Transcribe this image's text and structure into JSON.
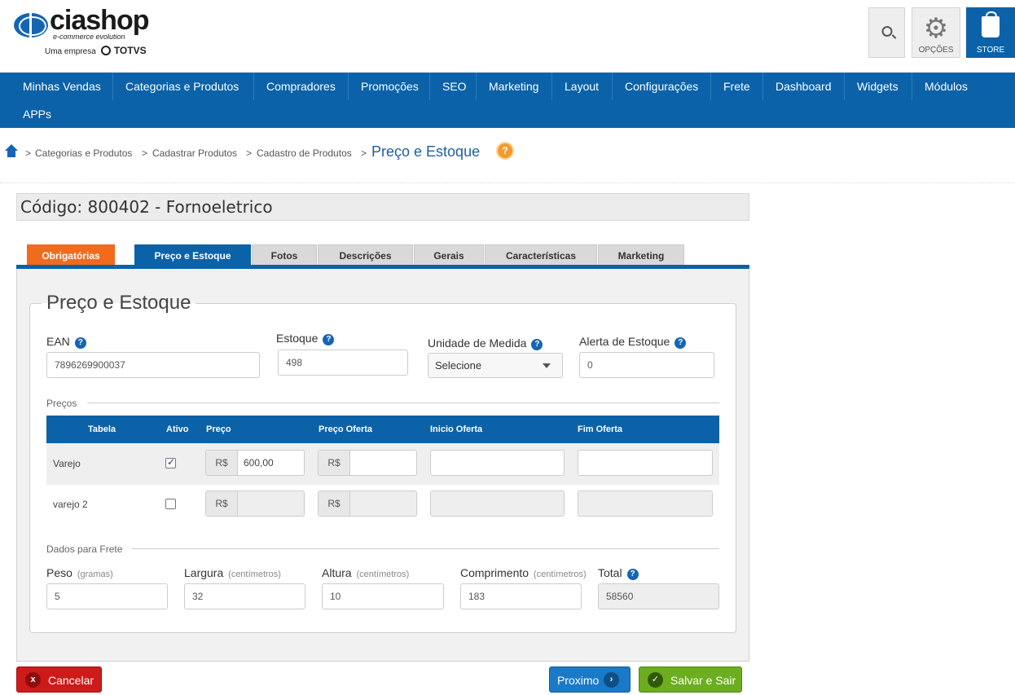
{
  "brand": {
    "name": "ciashop",
    "tagline": "e-commerce evolution",
    "sub_prefix": "Uma empresa",
    "sub_brand": "TOTVS"
  },
  "header": {
    "search_icon": "search-icon",
    "options_label": "OPÇÕES",
    "store_label": "STORE"
  },
  "nav": {
    "items": [
      "Minhas Vendas",
      "Categorias e Produtos",
      "Compradores",
      "Promoções",
      "SEO",
      "Marketing",
      "Layout",
      "Configurações",
      "Frete",
      "Dashboard",
      "Widgets",
      "Módulos",
      "APPs"
    ]
  },
  "breadcrumb": {
    "items": [
      "Categorias e Produtos",
      "Cadastrar Produtos",
      "Cadastro de Produtos"
    ],
    "separator": ">",
    "current": "Preço e Estoque",
    "help": "?"
  },
  "product": {
    "code_line": "Código: 800402 - Fornoeletrico"
  },
  "tabs": [
    "Obrigatórias",
    "Preço e Estoque",
    "Fotos",
    "Descrições",
    "Gerais",
    "Características",
    "Marketing"
  ],
  "form": {
    "legend": "Preço e Estoque",
    "ean": {
      "label": "EAN",
      "value": "7896269900037"
    },
    "estoque": {
      "label": "Estoque",
      "value": "498"
    },
    "unidade": {
      "label": "Unidade de Medida",
      "value": "Selecione"
    },
    "alerta": {
      "label": "Alerta de Estoque",
      "value": "0"
    },
    "help": "?"
  },
  "precos": {
    "section_label": "Preços",
    "columns": [
      "Tabela",
      "Ativo",
      "Preço",
      "Preço Oferta",
      "Inicio Oferta",
      "Fim Oferta"
    ],
    "currency": "R$",
    "rows": [
      {
        "tabela": "Varejo",
        "ativo": true,
        "preco": "600,00",
        "oferta": "",
        "inicio": "",
        "fim": ""
      },
      {
        "tabela": "varejo 2",
        "ativo": false,
        "preco": "",
        "oferta": "",
        "inicio": "",
        "fim": ""
      }
    ]
  },
  "frete": {
    "section_label": "Dados para Frete",
    "peso": {
      "label": "Peso",
      "unit": "(gramas)",
      "value": "5"
    },
    "largura": {
      "label": "Largura",
      "unit": "(centímetros)",
      "value": "32"
    },
    "altura": {
      "label": "Altura",
      "unit": "(centímetros)",
      "value": "10"
    },
    "comprimento": {
      "label": "Comprimento",
      "unit": "(centímetros)",
      "value": "183"
    },
    "total": {
      "label": "Total",
      "value": "58560"
    }
  },
  "actions": {
    "cancel": "Cancelar",
    "cancel_icon": "x",
    "next": "Proximo",
    "next_icon": "›",
    "save": "Salvar e Sair",
    "save_icon": "✓"
  },
  "colors": {
    "primary": "#0b62a8",
    "tab_required": "#f26b1d",
    "cancel": "#cf1a1a",
    "save": "#6cae1f"
  }
}
